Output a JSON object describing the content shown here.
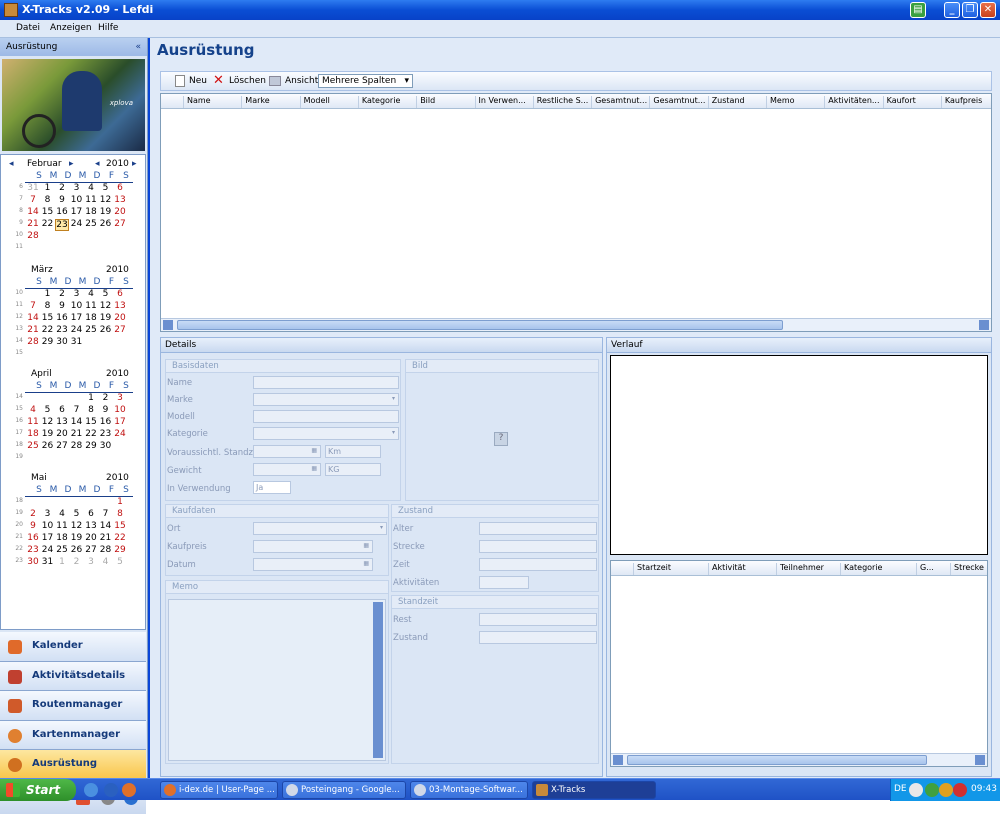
{
  "window": {
    "title": "X-Tracks v2.09 - Lefdi"
  },
  "menu": [
    "Datei",
    "Anzeigen",
    "Hilfe"
  ],
  "sidebar": {
    "header": "Ausrüstung",
    "collapse": "«",
    "photo_logo": "xplova",
    "calendar_dow": [
      "S",
      "M",
      "D",
      "M",
      "D",
      "F",
      "S"
    ],
    "months": [
      {
        "name": "Februar",
        "year": "2010",
        "weeks": [
          "6",
          "7",
          "8",
          "9",
          "10",
          "11"
        ],
        "rows": [
          [
            "31",
            "1",
            "2",
            "3",
            "4",
            "5",
            "6"
          ],
          [
            "7",
            "8",
            "9",
            "10",
            "11",
            "12",
            "13"
          ],
          [
            "14",
            "15",
            "16",
            "17",
            "18",
            "19",
            "20"
          ],
          [
            "21",
            "22",
            "23",
            "24",
            "25",
            "26",
            "27"
          ],
          [
            "28",
            "",
            "",
            "",
            "",
            "",
            ""
          ],
          [
            "",
            "",
            "",
            "",
            "",
            "",
            ""
          ]
        ]
      },
      {
        "name": "März",
        "year": "2010",
        "weeks": [
          "10",
          "11",
          "12",
          "13",
          "14",
          "15"
        ],
        "rows": [
          [
            "",
            "1",
            "2",
            "3",
            "4",
            "5",
            "6"
          ],
          [
            "7",
            "8",
            "9",
            "10",
            "11",
            "12",
            "13"
          ],
          [
            "14",
            "15",
            "16",
            "17",
            "18",
            "19",
            "20"
          ],
          [
            "21",
            "22",
            "23",
            "24",
            "25",
            "26",
            "27"
          ],
          [
            "28",
            "29",
            "30",
            "31",
            "",
            "",
            ""
          ],
          [
            "",
            "",
            "",
            "",
            "",
            "",
            ""
          ]
        ]
      },
      {
        "name": "April",
        "year": "2010",
        "weeks": [
          "14",
          "15",
          "16",
          "17",
          "18",
          "19"
        ],
        "rows": [
          [
            "",
            "",
            "",
            "",
            "1",
            "2",
            "3"
          ],
          [
            "4",
            "5",
            "6",
            "7",
            "8",
            "9",
            "10"
          ],
          [
            "11",
            "12",
            "13",
            "14",
            "15",
            "16",
            "17"
          ],
          [
            "18",
            "19",
            "20",
            "21",
            "22",
            "23",
            "24"
          ],
          [
            "25",
            "26",
            "27",
            "28",
            "29",
            "30",
            ""
          ],
          [
            "",
            "",
            "",
            "",
            "",
            "",
            ""
          ]
        ]
      },
      {
        "name": "Mai",
        "year": "2010",
        "weeks": [
          "18",
          "19",
          "20",
          "21",
          "22",
          "23"
        ],
        "rows": [
          [
            "",
            "",
            "",
            "",
            "",
            "",
            "1"
          ],
          [
            "2",
            "3",
            "4",
            "5",
            "6",
            "7",
            "8"
          ],
          [
            "9",
            "10",
            "11",
            "12",
            "13",
            "14",
            "15"
          ],
          [
            "16",
            "17",
            "18",
            "19",
            "20",
            "21",
            "22"
          ],
          [
            "23",
            "24",
            "25",
            "26",
            "27",
            "28",
            "29"
          ],
          [
            "30",
            "31",
            "1",
            "2",
            "3",
            "4",
            "5"
          ]
        ]
      }
    ],
    "nav": [
      "Kalender",
      "Aktivitätsdetails",
      "Routenmanager",
      "Kartenmanager",
      "Ausrüstung"
    ],
    "nav_active": "Ausrüstung"
  },
  "main": {
    "title": "Ausrüstung",
    "toolbar": {
      "new": "Neu",
      "delete": "Löschen",
      "view": "Ansicht",
      "view_select": "Mehrere Spalten"
    },
    "grid_columns": [
      "Name",
      "Marke",
      "Modell",
      "Kategorie",
      "Bild",
      "In Verwen...",
      "Restliche S...",
      "Gesamtnut...",
      "Gesamtnut...",
      "Zustand",
      "Memo",
      "Aktivitäten...",
      "Kaufort",
      "Kaufpreis"
    ],
    "details": {
      "title": "Details",
      "basisdaten": "Basisdaten",
      "bild": "Bild",
      "fields": {
        "name": "Name",
        "marke": "Marke",
        "modell": "Modell",
        "kategorie": "Kategorie",
        "standzeit": "Voraussichtl. Standzt.",
        "gewicht": "Gewicht",
        "inverwendung": "In Verwendung"
      },
      "units": {
        "km": "Km",
        "kg": "KG"
      },
      "ja": "Ja",
      "kaufdaten": "Kaufdaten",
      "kauf": {
        "ort": "Ort",
        "preis": "Kaufpreis",
        "datum": "Datum"
      },
      "zustand": "Zustand",
      "zustand_fields": {
        "alter": "Alter",
        "strecke": "Strecke",
        "zeit": "Zeit",
        "aktivitaeten": "Aktivitäten"
      },
      "memo": "Memo",
      "standzeit": "Standzeit",
      "standzeit_fields": {
        "rest": "Rest",
        "zustand": "Zustand"
      }
    },
    "verlauf": {
      "title": "Verlauf",
      "columns": [
        "Startzeit",
        "Aktivität",
        "Teilnehmer",
        "Kategorie",
        "G...",
        "Strecke"
      ]
    }
  },
  "taskbar": {
    "start": "Start",
    "tasks": [
      "i-dex.de | User-Page ...",
      "Posteingang - Google...",
      "03-Montage-Softwar...",
      "X-Tracks"
    ],
    "lang": "DE",
    "clock": "09:43"
  }
}
